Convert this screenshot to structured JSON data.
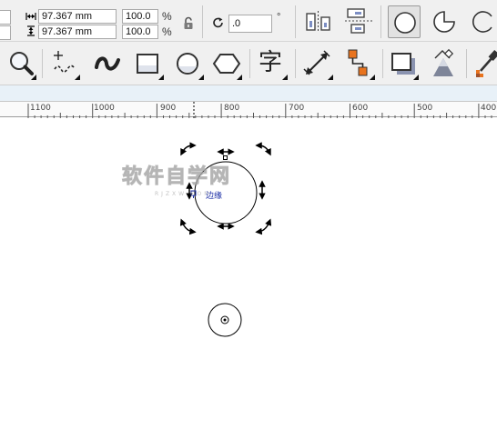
{
  "property_bar": {
    "width_value": "97.367 mm",
    "height_value": "97.367 mm",
    "scale_x": "100.0",
    "scale_y": "100.0",
    "percent_symbol": "%",
    "rotation_value": ".0",
    "degree_symbol": "°",
    "ellipse_mode": "ellipse",
    "icons": [
      "width-icon",
      "height-icon",
      "lock-ratio-icon",
      "rotation-icon",
      "mirror-horizontal-icon",
      "mirror-vertical-icon",
      "ellipse-mode-icon",
      "pie-mode-icon",
      "arc-mode-icon"
    ]
  },
  "toolbox": {
    "tools": [
      "zoom-tool",
      "freehand-tool",
      "artistic-media-tool",
      "rectangle-tool",
      "ellipse-tool",
      "polygon-tool",
      "text-tool",
      "dimension-tool",
      "connector-tool",
      "drop-shadow-tool",
      "transparency-tool",
      "eyedropper-tool"
    ],
    "text_tool_glyph": "字"
  },
  "ruler": {
    "labels": [
      "1100",
      "1000",
      "900",
      "800",
      "700",
      "600",
      "500",
      "400"
    ]
  },
  "canvas": {
    "watermark": "软件自学网",
    "watermark_sub": "RJZXW.COM",
    "node_hint": "边缘",
    "accent_color": "#1c2fa6"
  }
}
